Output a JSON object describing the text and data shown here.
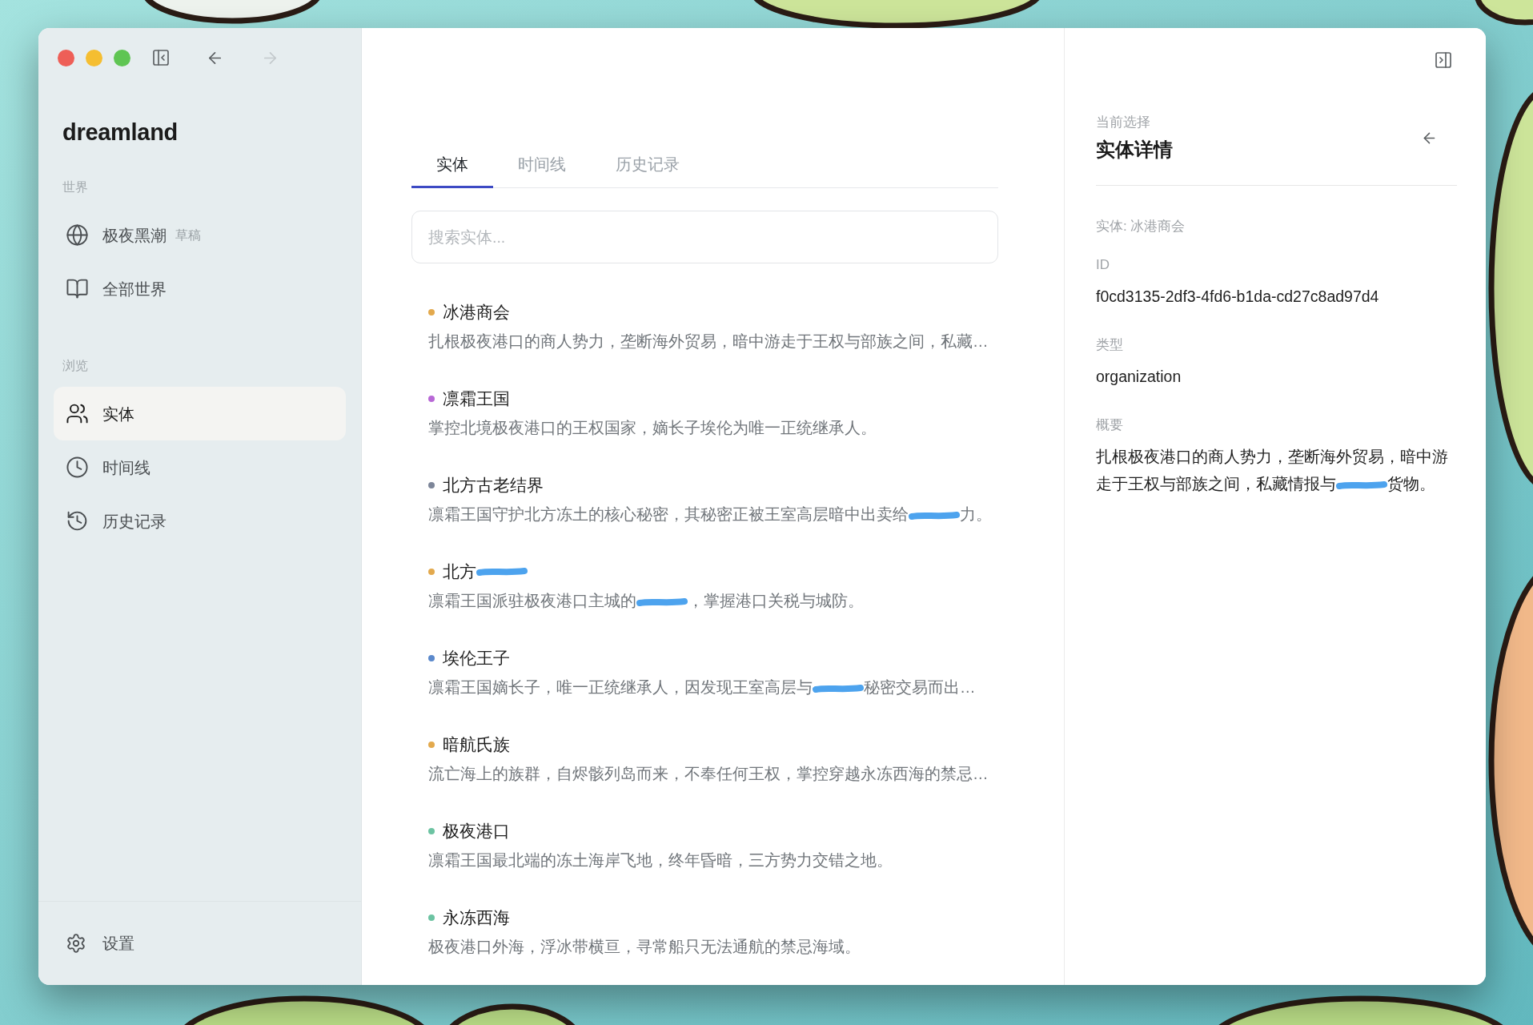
{
  "toolbar": {
    "back": {
      "disabled": false
    },
    "forward": {
      "disabled": true
    }
  },
  "sidebar": {
    "app_name": "dreamland",
    "sections": [
      {
        "title": "世界",
        "items": [
          {
            "label": "极夜黑潮",
            "badge": "草稿",
            "selected": false
          },
          {
            "label": "全部世界",
            "selected": false
          }
        ]
      },
      {
        "title": "浏览",
        "items": [
          {
            "label": "实体",
            "selected": true
          },
          {
            "label": "时间线",
            "selected": false
          },
          {
            "label": "历史记录",
            "selected": false
          }
        ]
      }
    ],
    "footer": {
      "label": "设置"
    }
  },
  "main": {
    "tabs": [
      {
        "label": "实体",
        "selected": true
      },
      {
        "label": "时间线",
        "selected": false
      },
      {
        "label": "历史记录",
        "selected": false
      }
    ],
    "search": {
      "placeholder": "搜索实体..."
    },
    "entities": [
      {
        "color": "#e3a94d",
        "name": [
          {
            "kind": "text",
            "text": "冰港商会"
          }
        ],
        "description": [
          {
            "kind": "text",
            "text": "扎根极夜港口的商人势力，垄断海外贸易，暗中游走于王权与部族之间，私藏…"
          }
        ]
      },
      {
        "color": "#b868d6",
        "name": [
          {
            "kind": "text",
            "text": "凛霜王国"
          }
        ],
        "description": [
          {
            "kind": "text",
            "text": "掌控北境极夜港口的王权国家，嫡长子埃伦为唯一正统继承人。"
          }
        ]
      },
      {
        "color": "#7d8699",
        "name": [
          {
            "kind": "text",
            "text": "北方古老结界"
          }
        ],
        "description": [
          {
            "kind": "text",
            "text": "凛霜王国守护北方冻土的核心秘密，其秘密正被王室高层暗中出卖给"
          },
          {
            "kind": "redaction"
          },
          {
            "kind": "text",
            "text": "力。"
          }
        ]
      },
      {
        "color": "#e3a94d",
        "name": [
          {
            "kind": "text",
            "text": "北方"
          },
          {
            "kind": "redaction"
          }
        ],
        "description": [
          {
            "kind": "text",
            "text": "凛霜王国派驻极夜港口主城的"
          },
          {
            "kind": "redaction"
          },
          {
            "kind": "text",
            "text": "，掌握港口关税与城防。"
          }
        ]
      },
      {
        "color": "#5b89cc",
        "name": [
          {
            "kind": "text",
            "text": "埃伦王子"
          }
        ],
        "description": [
          {
            "kind": "text",
            "text": "凛霜王国嫡长子，唯一正统继承人，因发现王室高层与"
          },
          {
            "kind": "redaction"
          },
          {
            "kind": "text",
            "text": "秘密交易而出…"
          }
        ]
      },
      {
        "color": "#e3a94d",
        "name": [
          {
            "kind": "text",
            "text": "暗航氏族"
          }
        ],
        "description": [
          {
            "kind": "text",
            "text": "流亡海上的族群，自烬骸列岛而来，不奉任何王权，掌控穿越永冻西海的禁忌…"
          }
        ]
      },
      {
        "color": "#6cc3a2",
        "name": [
          {
            "kind": "text",
            "text": "极夜港口"
          }
        ],
        "description": [
          {
            "kind": "text",
            "text": "凛霜王国最北端的冻土海岸飞地，终年昏暗，三方势力交错之地。"
          }
        ]
      },
      {
        "color": "#6cc3a2",
        "name": [
          {
            "kind": "text",
            "text": "永冻西海"
          }
        ],
        "description": [
          {
            "kind": "text",
            "text": "极夜港口外海，浮冰带横亘，寻常船只无法通航的禁忌海域。"
          }
        ]
      }
    ]
  },
  "detail": {
    "eyebrow": "当前选择",
    "title": "实体详情",
    "subtitle": "实体: 冰港商会",
    "fields": [
      {
        "label": "ID",
        "value": [
          {
            "kind": "text",
            "text": "f0cd3135-2df3-4fd6-b1da-cd27c8ad97d4"
          }
        ]
      },
      {
        "label": "类型",
        "value": [
          {
            "kind": "text",
            "text": "organization"
          }
        ]
      },
      {
        "label": "概要",
        "value": [
          {
            "kind": "text",
            "text": "扎根极夜港口的商人势力，垄断海外贸易，暗中游"
          },
          {
            "kind": "text",
            "text": "走于王权与部族之间，私藏情报与"
          },
          {
            "kind": "redaction"
          },
          {
            "kind": "text",
            "text": "货物。"
          }
        ]
      }
    ]
  }
}
